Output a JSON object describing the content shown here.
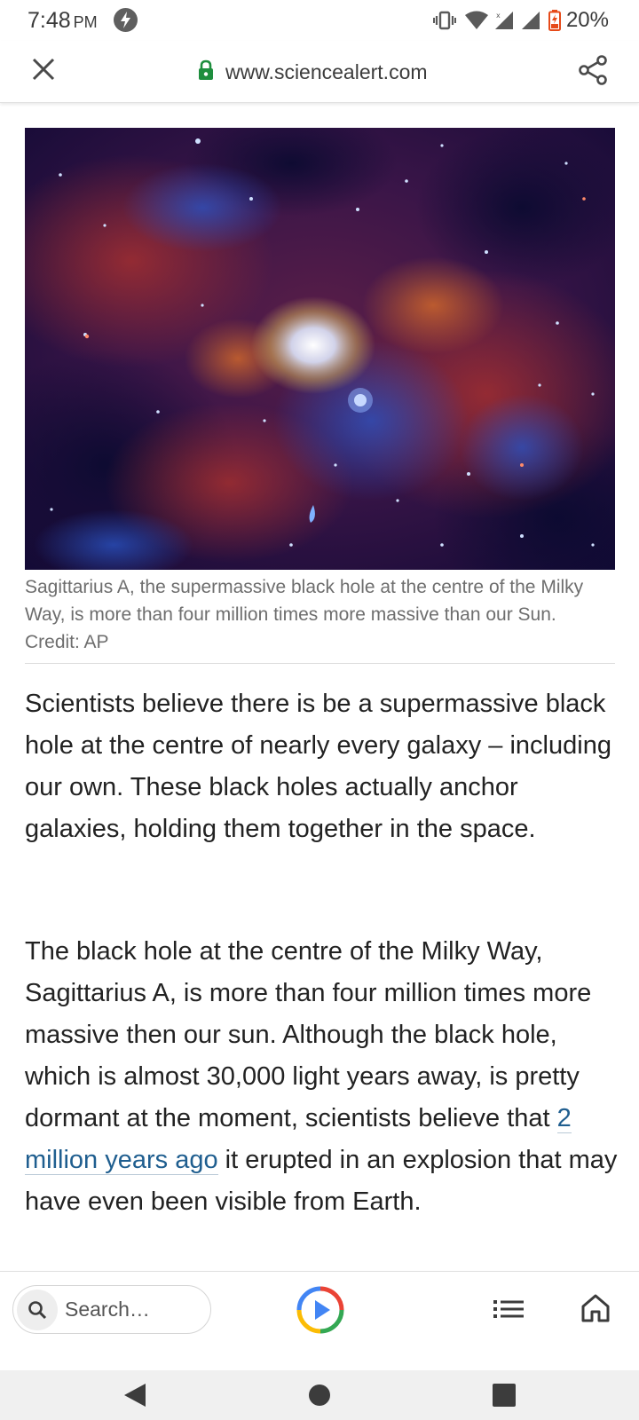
{
  "status_bar": {
    "time": "7:48",
    "ampm": "PM",
    "battery": "20%",
    "icons": [
      "flash-notification-icon",
      "vibrate-icon",
      "wifi-icon",
      "signal-icon",
      "signal-icon",
      "battery-charging-icon"
    ]
  },
  "browser": {
    "url": "www.sciencealert.com",
    "icons": {
      "close": "close-icon",
      "lock": "lock-icon",
      "share": "share-icon"
    },
    "accent_lock": "#1e8e3e"
  },
  "article": {
    "image_caption": "Sagittarius A, the supermassive black hole at the centre of the Milky Way, is more than four million times more massive than our Sun. Credit: AP",
    "paragraph_1": "Scientists believe there is be a supermassive black hole at the centre of nearly every galaxy – including our own. These black holes actually anchor galaxies, holding them together in the space.",
    "paragraph_2_before": "The black hole at the centre of the Milky Way, Sagittarius A, is more than four million times more massive then our sun. Although the black hole, which is almost 30,000 light years away, is pretty dormant at the moment, scientists believe that ",
    "paragraph_2_link": "2 million years ago",
    "paragraph_2_after": " it erupted in an explosion that may have even been visible from Earth.",
    "link_color": "#1f5e8f"
  },
  "toolbar": {
    "search_placeholder": "Search…",
    "icons": [
      "search-icon",
      "google-play-icon",
      "list-menu-icon",
      "home-icon"
    ]
  },
  "nav_bar": {
    "icons": [
      "back-icon",
      "home-circle-icon",
      "recents-icon"
    ]
  }
}
